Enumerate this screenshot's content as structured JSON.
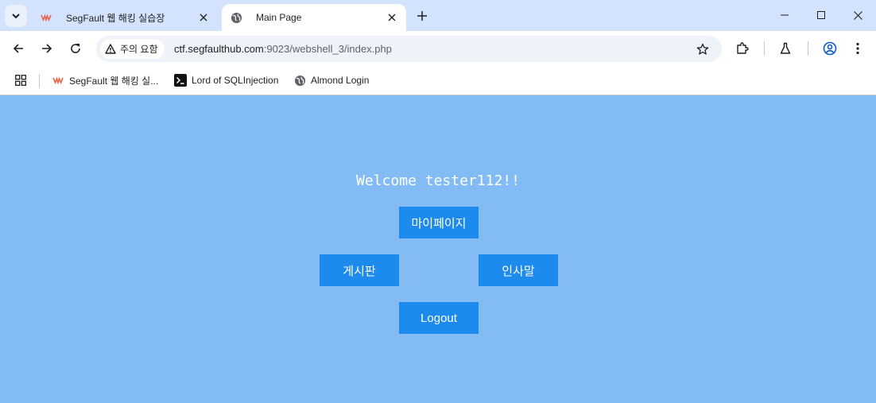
{
  "browser": {
    "tabs": [
      {
        "title": "SegFault 웹 해킹 실습장",
        "favicon": "segfault-logo-icon",
        "active": false
      },
      {
        "title": "Main Page",
        "favicon": "globe-icon",
        "active": true
      }
    ],
    "omnibox": {
      "security_label": "주의 요함",
      "url_host": "ctf.segfaulthub.com",
      "url_rest": ":9023/webshell_3/index.php"
    },
    "bookmarks": [
      {
        "label": "SegFault 웹 해킹 실...",
        "icon": "segfault-logo-icon"
      },
      {
        "label": "Lord of SQLInjection",
        "icon": "terminal-icon"
      },
      {
        "label": "Almond Login",
        "icon": "globe-icon"
      }
    ]
  },
  "page": {
    "background": "#83bcf5",
    "button_color": "#1d8aee",
    "welcome_text": "Welcome tester112!!",
    "buttons": {
      "mypage": "마이페이지",
      "board": "게시판",
      "greeting": "인사말",
      "logout": "Logout"
    }
  }
}
